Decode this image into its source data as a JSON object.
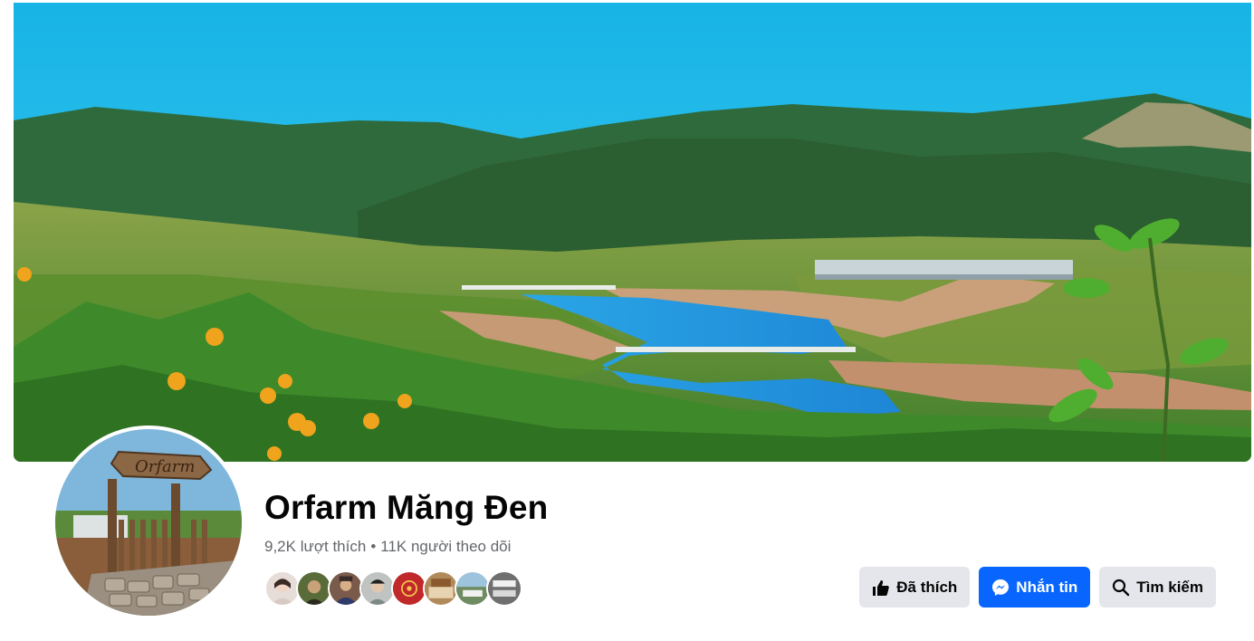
{
  "page": {
    "name": "Orfarm Măng Đen",
    "likes": "9,2K lượt thích",
    "separator": "•",
    "followers": "11K người theo dõi"
  },
  "avatar": {
    "sign_text": "Orfarm"
  },
  "friends": [
    {
      "name": "friend-avatar-1",
      "color": "#d9c9c3"
    },
    {
      "name": "friend-avatar-2",
      "color": "#5a6b3a"
    },
    {
      "name": "friend-avatar-3",
      "color": "#4b3a3a"
    },
    {
      "name": "friend-avatar-4",
      "color": "#a6a8a6"
    },
    {
      "name": "friend-avatar-5",
      "color": "#c0282a"
    },
    {
      "name": "friend-avatar-6",
      "color": "#b08a5a"
    },
    {
      "name": "friend-avatar-7",
      "color": "#6f8b61"
    },
    {
      "name": "friend-avatar-8",
      "color": "#777777"
    }
  ],
  "actions": {
    "liked_label": "Đã thích",
    "liked_icon": "thumbs-up-icon",
    "message_label": "Nhắn tin",
    "message_icon": "messenger-icon",
    "search_label": "Tìm kiếm",
    "search_icon": "search-icon"
  },
  "colors": {
    "primary": "#0866ff",
    "secondary_button": "#e4e6eb",
    "muted_text": "#65676b"
  }
}
